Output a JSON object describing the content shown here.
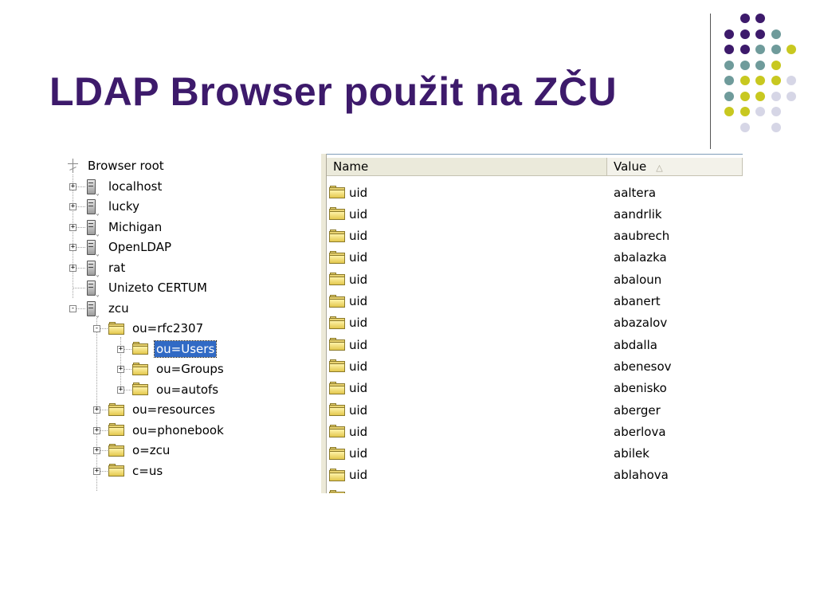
{
  "slide": {
    "title": "LDAP Browser použit na ZČU"
  },
  "colors": {
    "title": "#3d1a6b",
    "dot_purple": "#3d1a6b",
    "dot_teal": "#6f9b9b",
    "dot_olive": "#c8c820",
    "dot_lavender": "#d6d6e6",
    "selection": "#316ac5"
  },
  "tree": {
    "root_label": "Browser root",
    "servers": [
      {
        "label": "localhost",
        "expander": "+"
      },
      {
        "label": "lucky",
        "expander": "+"
      },
      {
        "label": "Michigan",
        "expander": "+"
      },
      {
        "label": "OpenLDAP",
        "expander": "+"
      },
      {
        "label": "rat",
        "expander": "+"
      },
      {
        "label": "Unizeto CERTUM",
        "expander": ""
      },
      {
        "label": "zcu",
        "expander": "−"
      }
    ],
    "zcu_children": [
      {
        "label": "ou=rfc2307",
        "expander": "−"
      },
      {
        "label": "ou=resources",
        "expander": "+"
      },
      {
        "label": "ou=phonebook",
        "expander": "+"
      },
      {
        "label": "o=zcu",
        "expander": "+"
      },
      {
        "label": "c=us",
        "expander": "+"
      }
    ],
    "rfc2307_children": [
      {
        "label": "ou=Users",
        "expander": "+",
        "selected": true
      },
      {
        "label": "ou=Groups",
        "expander": "+"
      },
      {
        "label": "ou=autofs",
        "expander": "+"
      }
    ]
  },
  "list": {
    "columns": {
      "name": "Name",
      "value": "Value",
      "sort_indicator": "△"
    },
    "rows": [
      {
        "name": "uid",
        "value": "aaltera"
      },
      {
        "name": "uid",
        "value": "aandrlik"
      },
      {
        "name": "uid",
        "value": "aaubrech"
      },
      {
        "name": "uid",
        "value": "abalazka"
      },
      {
        "name": "uid",
        "value": "abaloun"
      },
      {
        "name": "uid",
        "value": "abanert"
      },
      {
        "name": "uid",
        "value": "abazalov"
      },
      {
        "name": "uid",
        "value": "abdalla"
      },
      {
        "name": "uid",
        "value": "abenesov"
      },
      {
        "name": "uid",
        "value": "abenisko"
      },
      {
        "name": "uid",
        "value": "aberger"
      },
      {
        "name": "uid",
        "value": "aberlova"
      },
      {
        "name": "uid",
        "value": "abilek"
      },
      {
        "name": "uid",
        "value": "ablahova"
      }
    ]
  }
}
